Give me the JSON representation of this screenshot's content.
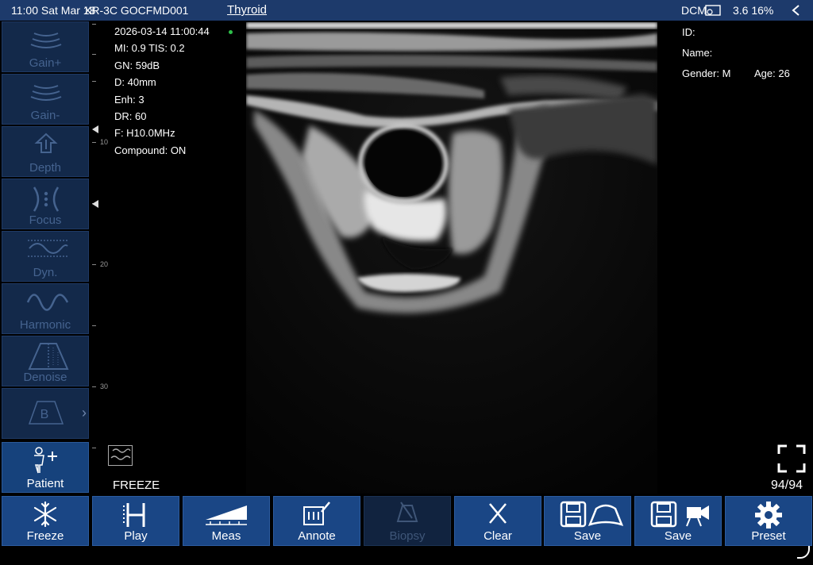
{
  "status_bar": {
    "time_date": "11:00  Sat Mar 18",
    "device": "XR-3C GOCFMD001",
    "preset": "Thyroid",
    "dcm_label": "DCM",
    "battery_info": "3.6  16%"
  },
  "sidebar": {
    "items": [
      {
        "label": "Gain+"
      },
      {
        "label": "Gain-"
      },
      {
        "label": "Depth"
      },
      {
        "label": "Focus"
      },
      {
        "label": "Dyn."
      },
      {
        "label": "Harmonic"
      },
      {
        "label": "Denoise"
      },
      {
        "label": "B"
      },
      {
        "label": "Patient"
      }
    ]
  },
  "depth_scale": {
    "labels": [
      "10",
      "20",
      "30"
    ]
  },
  "params": {
    "datetime": "2026-03-14 11:00:44",
    "mi_tis": "MI: 0.9  TIS: 0.2",
    "gain": "GN: 59dB",
    "depth": "D: 40mm",
    "enh": "Enh: 3",
    "dr": "DR: 60",
    "freq": "F: H10.0MHz",
    "compound": "Compound: ON"
  },
  "patient": {
    "id_label": "ID:",
    "name_label": "Name:",
    "gender": "Gender: M",
    "age": "Age: 26"
  },
  "freeze_status": "FREEZE",
  "frame_count": "94/94",
  "toolbar": {
    "buttons": [
      {
        "label": "Freeze"
      },
      {
        "label": "Play"
      },
      {
        "label": "Meas"
      },
      {
        "label": "Annote"
      },
      {
        "label": "Biopsy"
      },
      {
        "label": "Clear"
      },
      {
        "label": "Save"
      },
      {
        "label": "Save"
      },
      {
        "label": "Preset"
      }
    ]
  }
}
